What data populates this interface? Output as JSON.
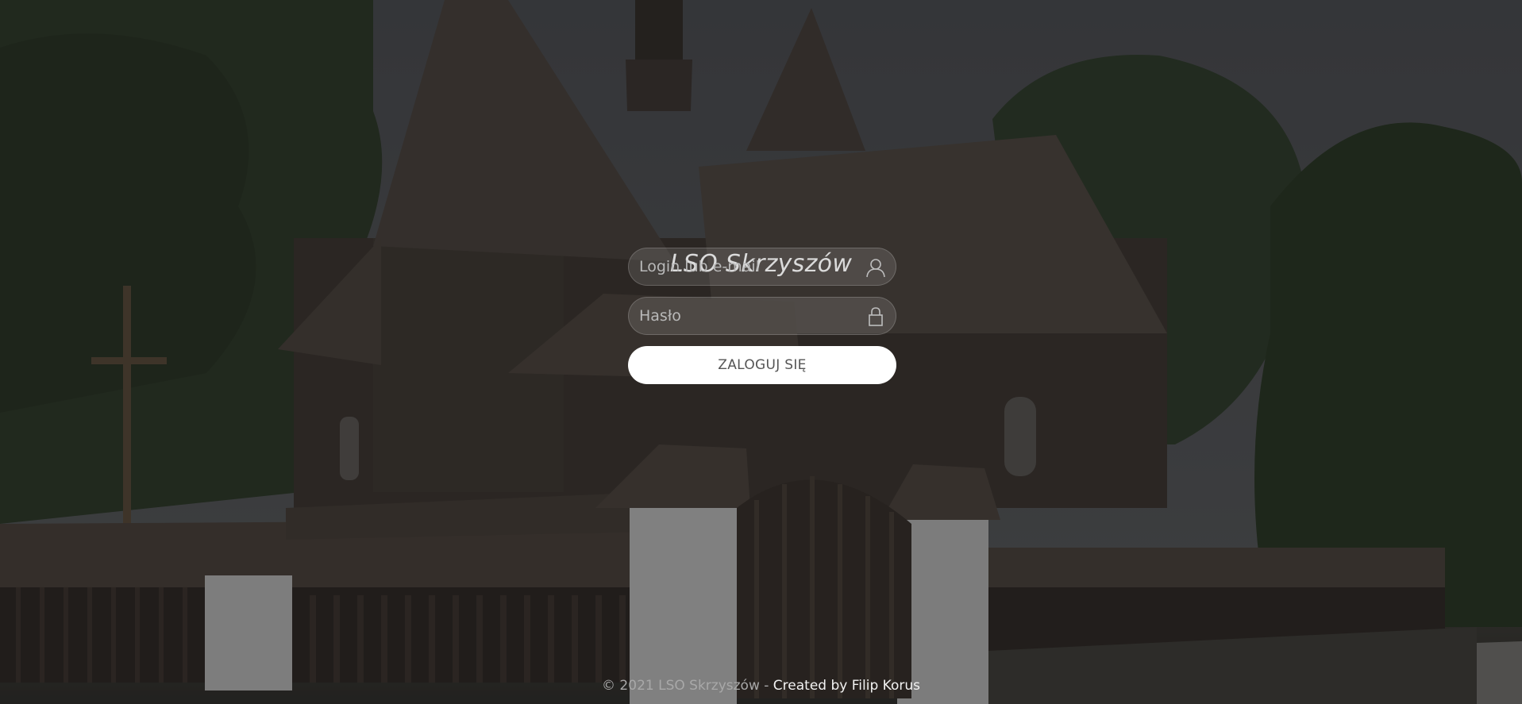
{
  "site": {
    "title": "LSO Skrzyszów"
  },
  "login_form": {
    "login_placeholder": "Login lub e-mail",
    "login_value": "",
    "login_icon": "user-icon",
    "password_placeholder": "Hasło",
    "password_value": "",
    "password_icon": "lock-icon",
    "submit_label": "ZALOGUJ SIĘ"
  },
  "footer": {
    "copyright": "© 2021 LSO Skrzyszów - ",
    "author_link": "Created by Filip Korus"
  },
  "colors": {
    "overlay": "#000000",
    "button_bg": "#ffffff",
    "button_text": "#555555",
    "title_text": "#d6d6d6"
  }
}
